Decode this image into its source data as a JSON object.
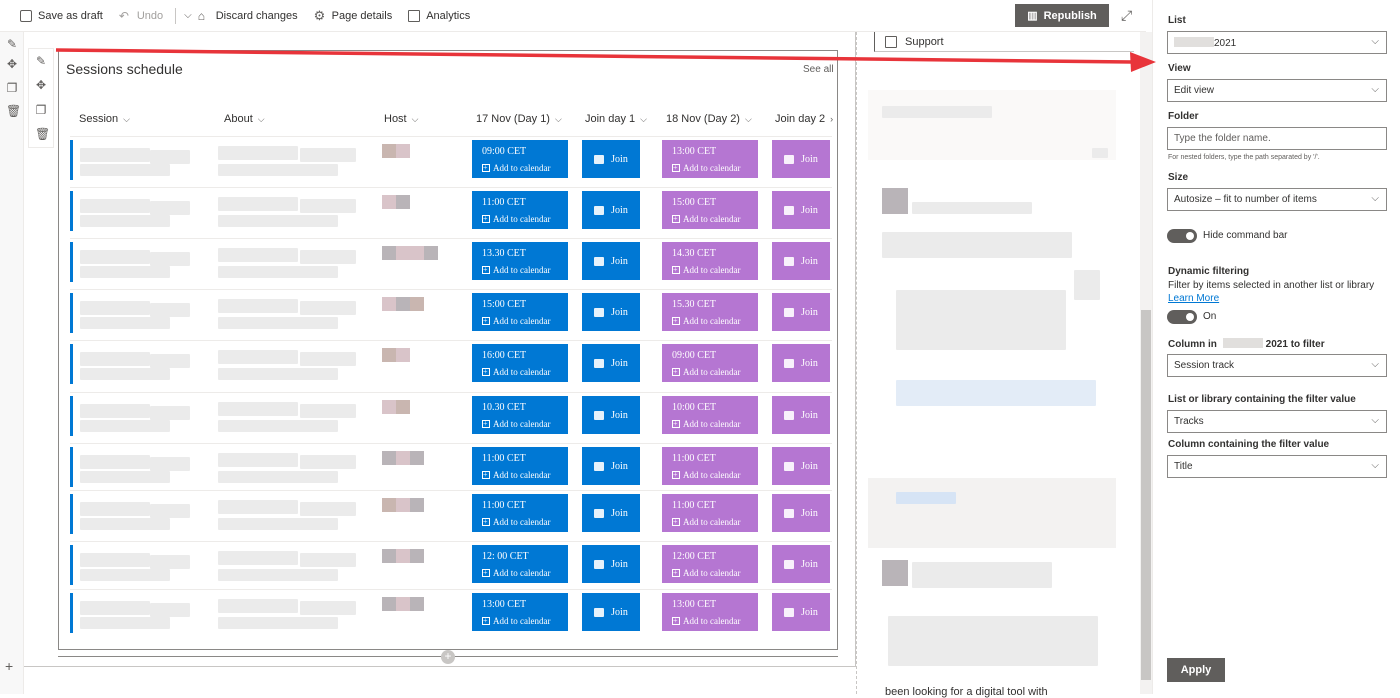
{
  "toolbar": {
    "save_draft": "Save as draft",
    "undo": "Undo",
    "discard": "Discard changes",
    "page_details": "Page details",
    "analytics": "Analytics",
    "republish": "Republish"
  },
  "webpart": {
    "title": "Sessions schedule",
    "see_all": "See all",
    "columns": [
      "Session",
      "About",
      "Host",
      "17 Nov (Day 1)",
      "Join day 1",
      "18 Nov (Day 2)",
      "Join day 2"
    ],
    "add_to_calendar": "Add to calendar",
    "join": "Join",
    "rows": [
      {
        "day1": "09:00 CET",
        "day2": "13:00 CET"
      },
      {
        "day1": "11:00 CET",
        "day2": "15:00 CET"
      },
      {
        "day1": "13.30 CET",
        "day2": "14.30 CET"
      },
      {
        "day1": "15:00 CET",
        "day2": "15.30 CET"
      },
      {
        "day1": "16:00 CET",
        "day2": "09:00 CET"
      },
      {
        "day1": "10.30 CET",
        "day2": "10:00 CET"
      },
      {
        "day1": "11:00 CET",
        "day2": "11:00 CET"
      },
      {
        "day1": "11:00 CET",
        "day2": "11:00 CET"
      },
      {
        "day1": "12: 00 CET",
        "day2": "12:00 CET"
      },
      {
        "day1": "13:00 CET",
        "day2": "13:00 CET"
      }
    ]
  },
  "right_column": {
    "support": "Support",
    "bottom_text": "been looking for a digital tool with"
  },
  "pane": {
    "list_label": "List",
    "list_value_suffix": "2021",
    "view_label": "View",
    "view_value": "Edit view",
    "folder_label": "Folder",
    "folder_placeholder": "Type the folder name.",
    "folder_hint": "For nested folders, type the path separated by '/'.",
    "size_label": "Size",
    "size_value": "Autosize – fit to number of items",
    "hide_command_bar": "Hide command bar",
    "dynamic_filtering": "Dynamic filtering",
    "dynamic_desc": "Filter by items selected in another list or library",
    "learn_more": "Learn More",
    "on": "On",
    "column_in_prefix": "Column in",
    "column_in_suffix": "2021 to filter",
    "column_in_value": "Session track",
    "list_library_label": "List or library containing the filter value",
    "list_library_value": "Tracks",
    "column_filter_label": "Column containing the filter value",
    "column_filter_value": "Title",
    "apply": "Apply"
  },
  "colors": {
    "day1": "#0078d4",
    "day2": "#b576d2",
    "arrow": "#e8343a",
    "republish": "#605e5c"
  }
}
